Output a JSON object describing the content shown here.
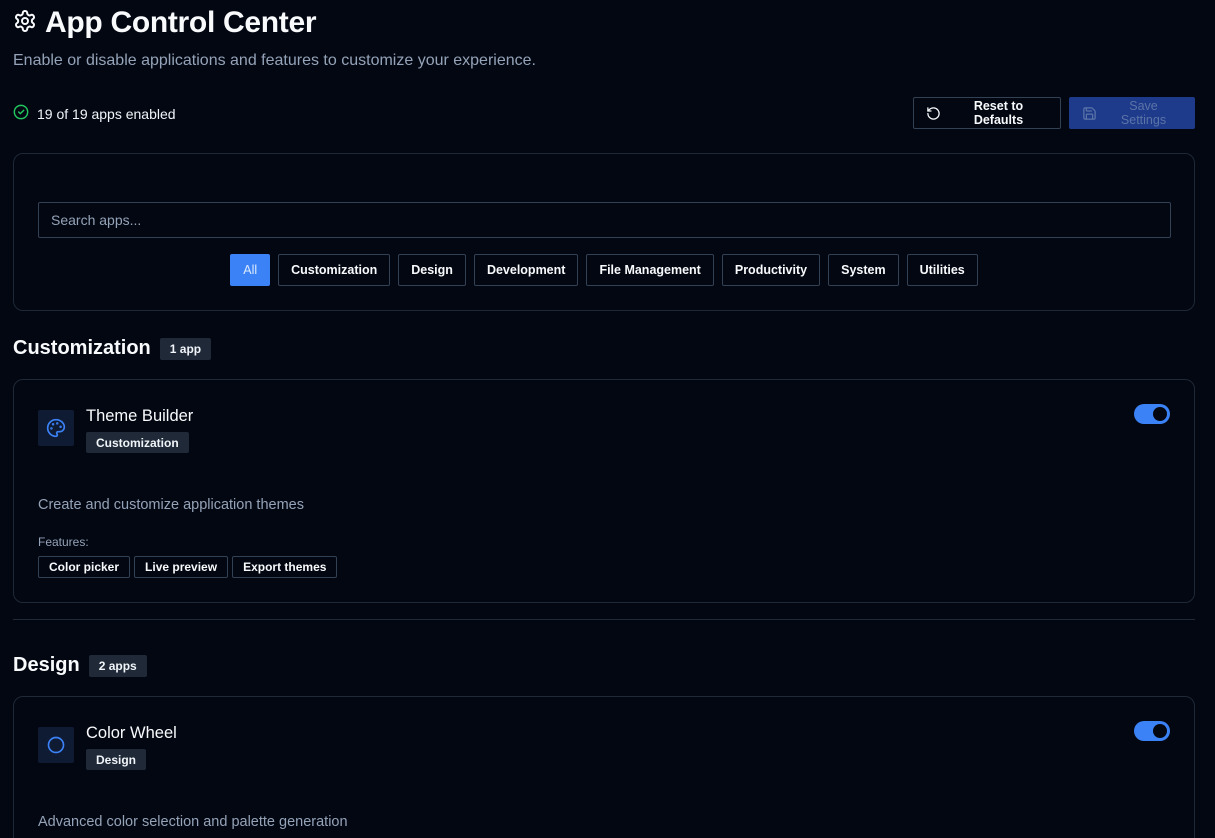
{
  "header": {
    "title": "App Control Center",
    "subtitle": "Enable or disable applications and features to customize your experience."
  },
  "status": {
    "text": "19 of 19 apps enabled",
    "color": "#22c55e"
  },
  "actions": {
    "reset_label": "Reset to Defaults",
    "save_label": "Save Settings"
  },
  "search": {
    "placeholder": "Search apps...",
    "value": ""
  },
  "filters": [
    "All",
    "Customization",
    "Design",
    "Development",
    "File Management",
    "Productivity",
    "System",
    "Utilities"
  ],
  "active_filter": "All",
  "sections": [
    {
      "title": "Customization",
      "count": "1 app",
      "apps": [
        {
          "name": "Theme Builder",
          "category": "Customization",
          "icon": "palette-icon",
          "enabled": true,
          "description": "Create and customize application themes",
          "features_label": "Features:",
          "features": [
            "Color picker",
            "Live preview",
            "Export themes"
          ]
        }
      ]
    },
    {
      "title": "Design",
      "count": "2 apps",
      "apps": [
        {
          "name": "Color Wheel",
          "category": "Design",
          "icon": "circle-icon",
          "enabled": true,
          "description": "Advanced color selection and palette generation"
        }
      ]
    }
  ],
  "colors": {
    "accent": "#3b82f6",
    "background": "#030712",
    "muted": "#94a3b8"
  }
}
